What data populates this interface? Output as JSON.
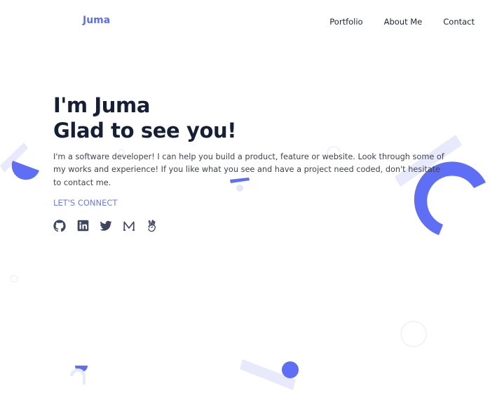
{
  "nav": {
    "logo": "Juma",
    "links": [
      "Portfolio",
      "About Me",
      "Contact"
    ]
  },
  "hero": {
    "line1": "I'm Juma",
    "line2": "Glad to see you!",
    "description": "I'm a software developer! I can help you build a product, feature or website. Look through some of my works and experience! If you like what you see and have a project need coded, don't hesitate to contact me.",
    "cta": "LET'S CONNECT"
  },
  "socials": [
    {
      "name": "GitHub",
      "icon": "github-icon"
    },
    {
      "name": "LinkedIn",
      "icon": "linkedin-icon"
    },
    {
      "name": "Twitter",
      "icon": "twitter-icon"
    },
    {
      "name": "Medium",
      "icon": "medium-icon"
    },
    {
      "name": "AngelList",
      "icon": "angellist-icon"
    }
  ],
  "colors": {
    "accent": "#5e6ff5",
    "accent_light": "#e8eafc",
    "heading": "#152037",
    "text": "#3e4350",
    "icon": "#3c4660"
  }
}
